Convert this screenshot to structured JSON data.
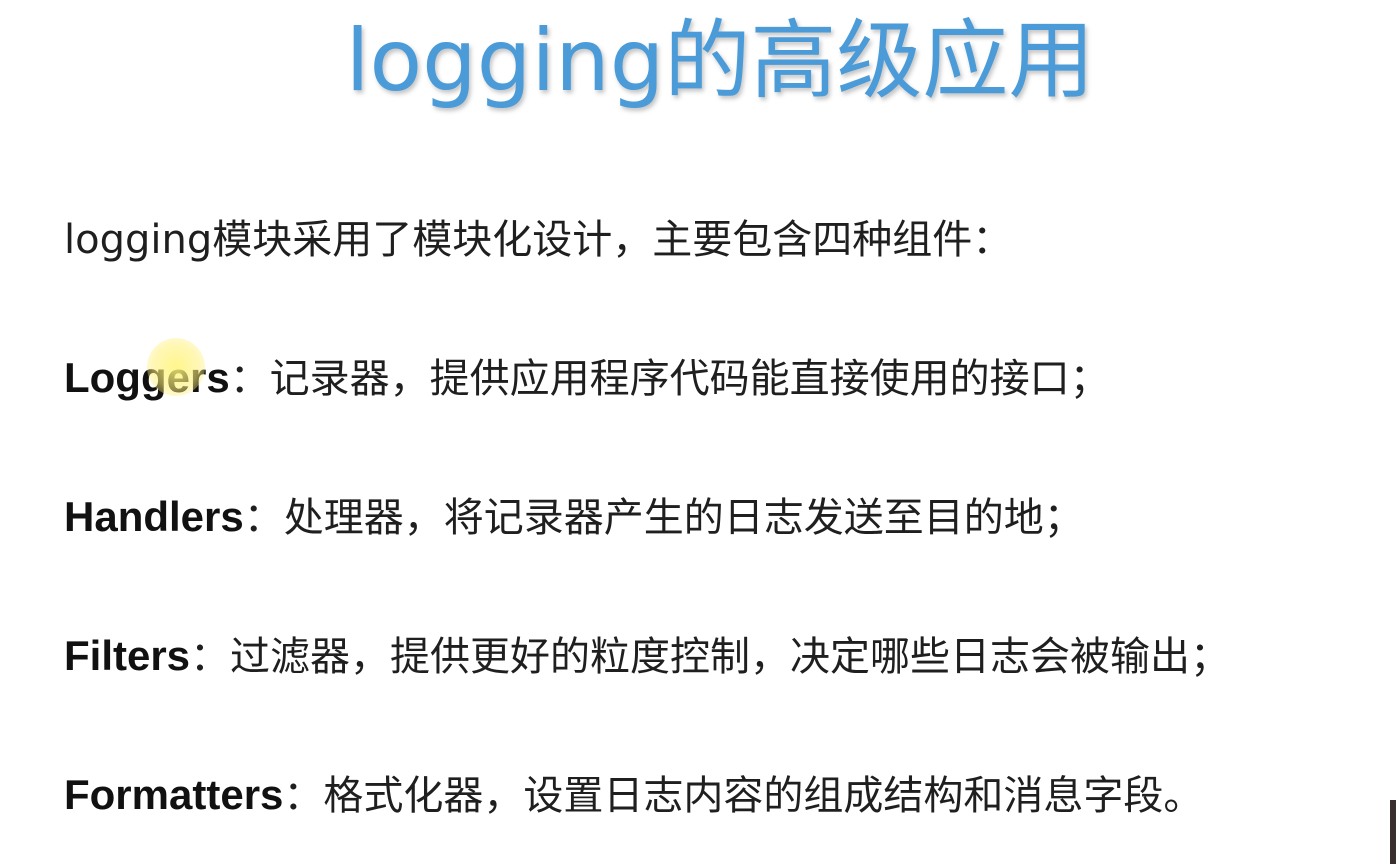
{
  "slide": {
    "title": "logging的高级应用",
    "intro": "logging模块采用了模块化设计，主要包含四种组件：",
    "components": [
      {
        "term": "Loggers",
        "description": "：记录器，提供应用程序代码能直接使用的接口；"
      },
      {
        "term": "Handlers",
        "description": "：处理器，将记录器产生的日志发送至目的地；"
      },
      {
        "term": "Filters",
        "description": "：过滤器，提供更好的粒度控制，决定哪些日志会被输出；"
      },
      {
        "term": "Formatters",
        "description": "：格式化器，设置日志内容的组成结构和消息字段。"
      }
    ]
  },
  "colors": {
    "title": "#4a9bd8",
    "body_text": "#1f1f1f",
    "cursor_highlight": "#fff078"
  }
}
